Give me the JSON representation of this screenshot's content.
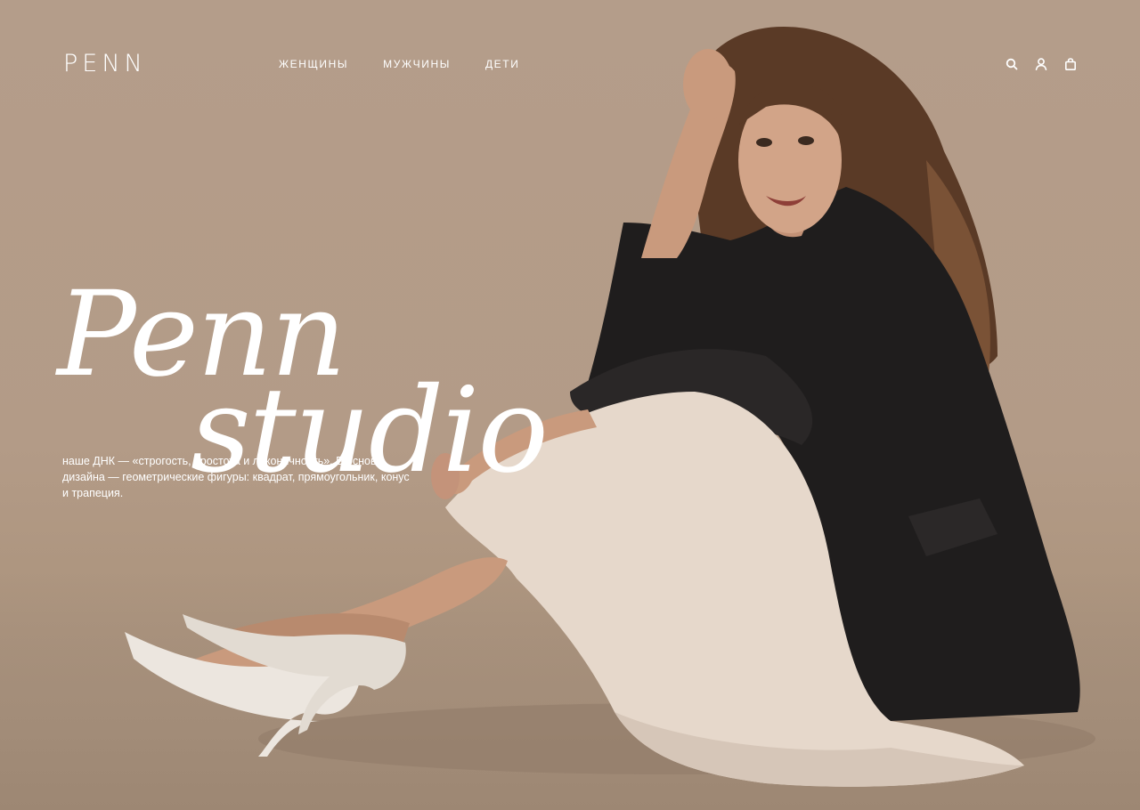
{
  "header": {
    "logo": "PENN",
    "nav": [
      "ЖЕНЩИНЫ",
      "МУЖЧИНЫ",
      "ДЕТИ"
    ],
    "icons": [
      "search-icon",
      "user-icon",
      "shopping-bag-icon"
    ]
  },
  "hero": {
    "title_line1": "Penn",
    "title_line2": "studio",
    "tagline": "наше ДНК — «строгость, простота и лаконичность». В основе дизайна —  геометрические фигуры: квадрат, прямоугольник, конус и трапеция."
  },
  "colors": {
    "background": "#b39b87",
    "text": "#ffffff",
    "jacket": "#1f1d1d",
    "skirt": "#e6d8cb",
    "shoes": "#ece6df",
    "hair": "#5a3a26",
    "skin": "#c99a7d"
  }
}
